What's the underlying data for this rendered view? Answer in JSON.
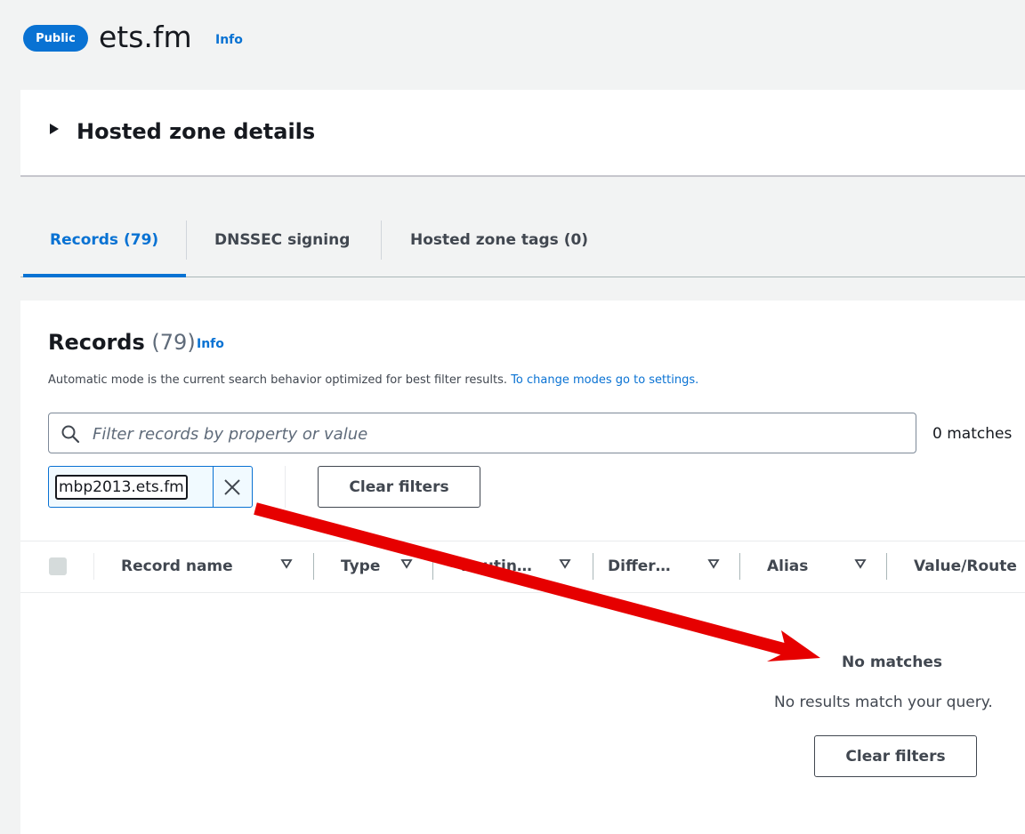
{
  "header": {
    "badge": "Public",
    "title": "ets.fm",
    "info": "Info"
  },
  "details": {
    "title": "Hosted zone details"
  },
  "tabs": [
    {
      "label": "Records (79)",
      "active": true
    },
    {
      "label": "DNSSEC signing",
      "active": false
    },
    {
      "label": "Hosted zone tags (0)",
      "active": false
    }
  ],
  "records": {
    "heading": "Records",
    "count": "(79)",
    "info": "Info",
    "description": "Automatic mode is the current search behavior optimized for best filter results.",
    "settings_link": "To change modes go to settings.",
    "search_placeholder": "Filter records by property or value",
    "matches": "0 matches",
    "token": "mbp2013.ets.fm",
    "clear_filters": "Clear filters",
    "columns": [
      "Record name",
      "Type",
      "Routin…",
      "Differ…",
      "Alias",
      "Value/Route"
    ],
    "empty_title": "No matches",
    "empty_text": "No results match your query.",
    "empty_button": "Clear filters"
  },
  "colors": {
    "accent": "#0972d3",
    "annotation_arrow": "#e60000"
  }
}
